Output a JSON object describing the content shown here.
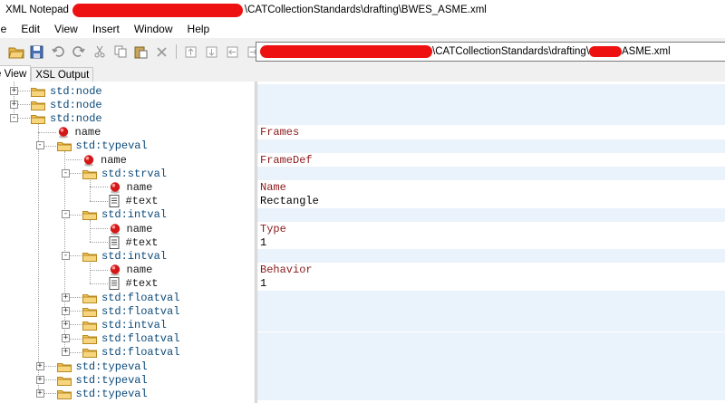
{
  "window": {
    "title_prefix": "XML Notepad",
    "title_suffix": "\\CATCollectionStandards\\drafting\\BWES_ASME.xml"
  },
  "menu": [
    "le",
    "Edit",
    "View",
    "Insert",
    "Window",
    "Help"
  ],
  "toolbar": {
    "icons": [
      "open-icon",
      "save-icon",
      "undo-icon",
      "redo-icon",
      "cut-icon",
      "copy-icon",
      "paste-icon",
      "delete-icon",
      "nudge-up-icon",
      "nudge-down-icon",
      "nudge-left-icon",
      "nudge-right-icon"
    ]
  },
  "address": {
    "middle": "\\CATCollectionStandards\\drafting\\",
    "suffix": "ASME.xml"
  },
  "tabs": {
    "tree_view": "e View",
    "xsl_output": "XSL Output"
  },
  "tree": [
    {
      "label": "std:node",
      "kind": "element",
      "level": 0,
      "expander": "+"
    },
    {
      "label": "std:node",
      "kind": "element",
      "level": 0,
      "expander": "+"
    },
    {
      "label": "std:node",
      "kind": "element",
      "level": 0,
      "expander": "-"
    },
    {
      "label": "name",
      "kind": "attribute",
      "level": 1,
      "expander": ""
    },
    {
      "label": "std:typeval",
      "kind": "element",
      "level": 1,
      "expander": "-"
    },
    {
      "label": "name",
      "kind": "attribute",
      "level": 2,
      "expander": ""
    },
    {
      "label": "std:strval",
      "kind": "element",
      "level": 2,
      "expander": "-"
    },
    {
      "label": "name",
      "kind": "attribute",
      "level": 3,
      "expander": ""
    },
    {
      "label": "#text",
      "kind": "text",
      "level": 3,
      "expander": ""
    },
    {
      "label": "std:intval",
      "kind": "element",
      "level": 2,
      "expander": "-"
    },
    {
      "label": "name",
      "kind": "attribute",
      "level": 3,
      "expander": ""
    },
    {
      "label": "#text",
      "kind": "text",
      "level": 3,
      "expander": ""
    },
    {
      "label": "std:intval",
      "kind": "element",
      "level": 2,
      "expander": "-"
    },
    {
      "label": "name",
      "kind": "attribute",
      "level": 3,
      "expander": ""
    },
    {
      "label": "#text",
      "kind": "text",
      "level": 3,
      "expander": ""
    },
    {
      "label": "std:floatval",
      "kind": "element",
      "level": 2,
      "expander": "+"
    },
    {
      "label": "std:floatval",
      "kind": "element",
      "level": 2,
      "expander": "+"
    },
    {
      "label": "std:intval",
      "kind": "element",
      "level": 2,
      "expander": "+"
    },
    {
      "label": "std:floatval",
      "kind": "element",
      "level": 2,
      "expander": "+"
    },
    {
      "label": "std:floatval",
      "kind": "element",
      "level": 2,
      "expander": "+"
    },
    {
      "label": "std:typeval",
      "kind": "element",
      "level": 1,
      "expander": "+"
    },
    {
      "label": "std:typeval",
      "kind": "element",
      "level": 1,
      "expander": "+"
    },
    {
      "label": "std:typeval",
      "kind": "element",
      "level": 1,
      "expander": "+"
    }
  ],
  "values": [
    "",
    "",
    "",
    "Frames",
    "",
    "FrameDef",
    "",
    "Name",
    "Rectangle",
    "",
    "Type",
    "1",
    "",
    "Behavior",
    "1",
    "",
    "",
    "",
    "",
    "",
    "",
    "",
    ""
  ]
}
